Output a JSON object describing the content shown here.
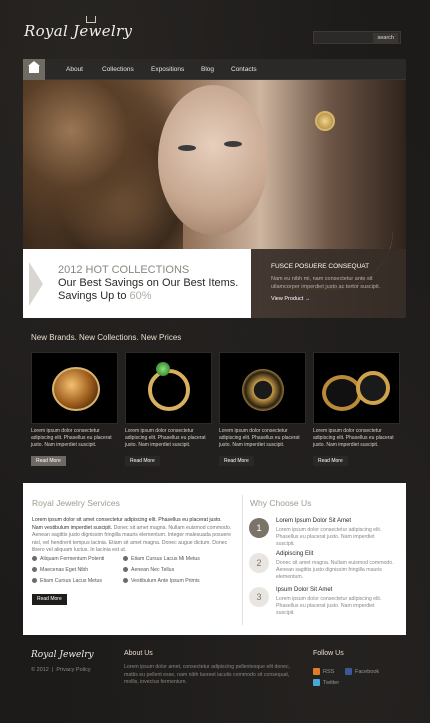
{
  "header": {
    "logo": "Royal Jewelry",
    "search_placeholder": "",
    "search_button": "search"
  },
  "nav": {
    "items": [
      "About",
      "Collections",
      "Expositions",
      "Blog",
      "Contacts"
    ]
  },
  "hero": {
    "collection_title": "2012 HOT COLLECTIONS",
    "line2": "Our Best Savings on Our Best Items.",
    "line3_prefix": "Savings Up to ",
    "line3_percent": "60%",
    "right_title": "FUSCE POSUERE CONSEQUAT",
    "right_text": "Nam eu nibh mi, nam consectetur ante sit ullamcorper imperdiet justo ac tortor suscipit.",
    "right_link": "View Product →"
  },
  "brands": {
    "title": "New Brands. New Collections. New Prices",
    "cards": [
      {
        "text": "Lorem ipsum dolor consectetur adipiscing elit. Phasellus eu placerat justo. Nam imperdiet suscipit.",
        "button": "Read More",
        "active": true
      },
      {
        "text": "Lorem ipsum dolor consectetur adipiscing elit. Phasellus eu placerat justo. Nam imperdiet suscipit.",
        "button": "Read More",
        "active": false
      },
      {
        "text": "Lorem ipsum dolor consectetur adipiscing elit. Phasellus eu placerat justo. Nam imperdiet suscipit.",
        "button": "Read More",
        "active": false
      },
      {
        "text": "Lorem ipsum dolor consectetur adipiscing elit. Phasellus eu placerat justo. Nam imperdiet suscipit.",
        "button": "Read More",
        "active": false
      }
    ]
  },
  "services": {
    "title": "Royal Jewelry Services",
    "text_bold": "Lorem ipsum dolor sit amet consectetur adipiscing elit. Phasellus eu placerat justo. Nam vestibulum imperdiet suscipit.",
    "text": "Donec sit amet magna. Nullam euismod commodo. Aenean sagittis justo dignissim fringilla mauris elementum. Integer malesuada posuere nisl, vel hendrerit tempus lacinia. Etiam sit amet magna. Donec augue dictum. Donec libero vel aliquam luctus. In lacinia est ut.",
    "list_left": [
      "Aliquam Fermentum Potenti",
      "Maecenas Eget Nibh",
      "Etiam Cursus Lacus Metus"
    ],
    "list_right": [
      "Etiam Cursus Lacus Mi Metus",
      "Aenean Nec Tellus",
      "Vestibulum Ante Ipsum Primis"
    ],
    "button": "Read More"
  },
  "why": {
    "title": "Why Choose Us",
    "items": [
      {
        "num": "1",
        "title": "Lorem Ipsum Dolor Sit Amet",
        "text": "Lorem ipsum dolor consectetur adipiscing elit. Phasellus eu placerat justo. Nam imperdiet suscipit."
      },
      {
        "num": "2",
        "title": "Adipiscing Elit",
        "text": "Donec sit amet magna. Nullam euismod commodo. Aenean sagittis justo dignissim fringilla mauris elementum."
      },
      {
        "num": "3",
        "title": "Ipsum Dolor Sit Amet",
        "text": "Lorem ipsum dolor consectetur adipiscing elit. Phasellus eu placerat justo. Nam imperdiet suscipit."
      }
    ]
  },
  "footer": {
    "logo": "Royal Jewelry",
    "copyright": "© 2012",
    "privacy": "Privacy Policy",
    "about_title": "About Us",
    "about_text": "Lorem ipsum dolor amet, consectetur adipiscing pellentesque elit donec, mattis eu pellent esse, nam nibh laoreet iaculis commodo sit consequat, mollis, invectus fermentum.",
    "follow_title": "Follow Us",
    "social": [
      "RSS",
      "Facebook",
      "Twitter"
    ]
  },
  "colors": {
    "accent": "#8f8a80",
    "rss": "#e07b27",
    "facebook": "#3b5998",
    "twitter": "#4aa8d8"
  }
}
